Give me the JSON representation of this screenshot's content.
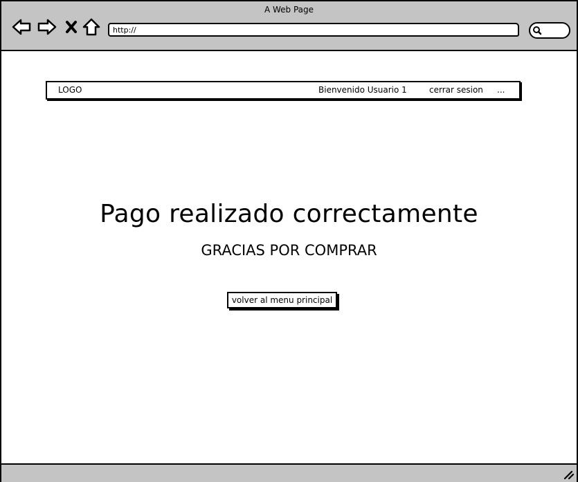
{
  "window": {
    "title": "A Web Page"
  },
  "toolbar": {
    "url": "http://"
  },
  "header": {
    "logo": "LOGO",
    "welcome": "Bienvenido Usuario 1",
    "logout": "cerrar sesion",
    "more": "..."
  },
  "main": {
    "title": "Pago realizado correctamente",
    "subtitle": "GRACIAS POR COMPRAR",
    "back_button": "volver al menu principal"
  },
  "icons": {
    "back": "back-arrow-icon",
    "forward": "forward-arrow-icon",
    "stop": "close-icon",
    "home": "home-icon",
    "search": "search-icon",
    "resize": "resize-grip-icon"
  }
}
